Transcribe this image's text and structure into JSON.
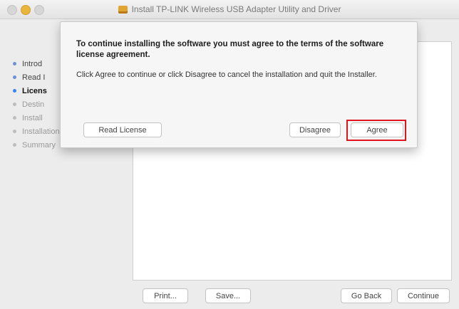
{
  "window": {
    "title": "Install TP-LINK Wireless USB Adapter Utility and Driver"
  },
  "sidebar": {
    "steps": [
      {
        "label": "Introd",
        "state": "done"
      },
      {
        "label": "Read I",
        "state": "done"
      },
      {
        "label": "Licens",
        "state": "current"
      },
      {
        "label": "Destin",
        "state": "pending"
      },
      {
        "label": "Install",
        "state": "pending"
      },
      {
        "label": "Installation",
        "state": "pending"
      },
      {
        "label": "Summary",
        "state": "pending"
      }
    ]
  },
  "bottom_buttons": {
    "print": "Print...",
    "save": "Save...",
    "go_back": "Go Back",
    "continue": "Continue"
  },
  "sheet": {
    "heading": "To continue installing the software you must agree to the terms of the software license agreement.",
    "body": "Click Agree to continue or click Disagree to cancel the installation and quit the Installer.",
    "read_license": "Read License",
    "disagree": "Disagree",
    "agree": "Agree"
  },
  "colors": {
    "highlight": "#e0141e",
    "current_step": "#3b82f6"
  }
}
